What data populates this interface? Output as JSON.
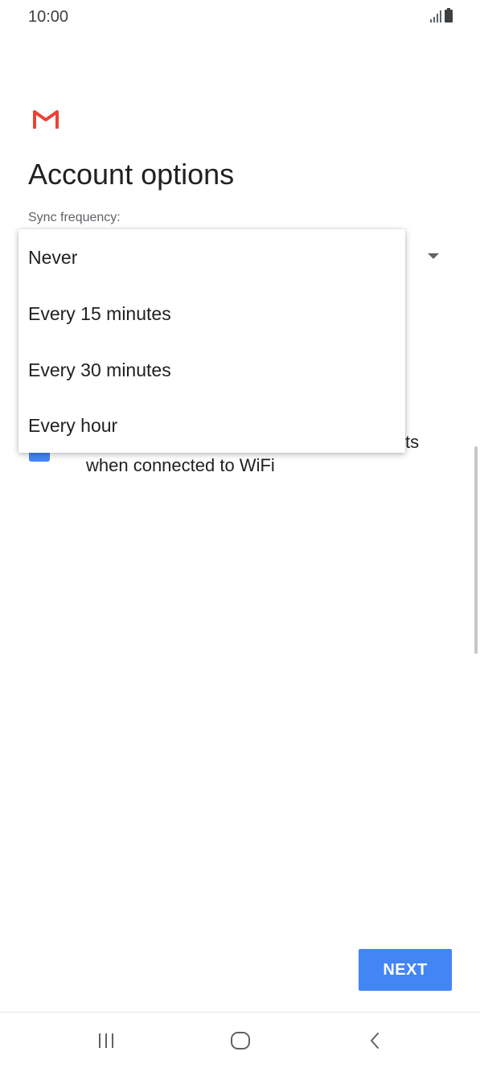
{
  "status_bar": {
    "time": "10:00",
    "icons": [
      "signal-icon",
      "battery-icon"
    ]
  },
  "app": {
    "logo": "gmail-logo-icon",
    "colors": {
      "gmail_red": "#EA4335",
      "accent_blue": "#4285F4"
    }
  },
  "page": {
    "title": "Account options"
  },
  "sync": {
    "label": "Sync frequency:",
    "options": [
      "Never",
      "Every 15 minutes",
      "Every 30 minutes",
      "Every hour"
    ]
  },
  "background_option": {
    "checked": true,
    "text_line1_end": "ts",
    "text_line2": "when connected to WiFi"
  },
  "buttons": {
    "next": "NEXT"
  },
  "nav_bar": {
    "icons": [
      "recent-apps-icon",
      "home-icon",
      "back-icon"
    ]
  }
}
